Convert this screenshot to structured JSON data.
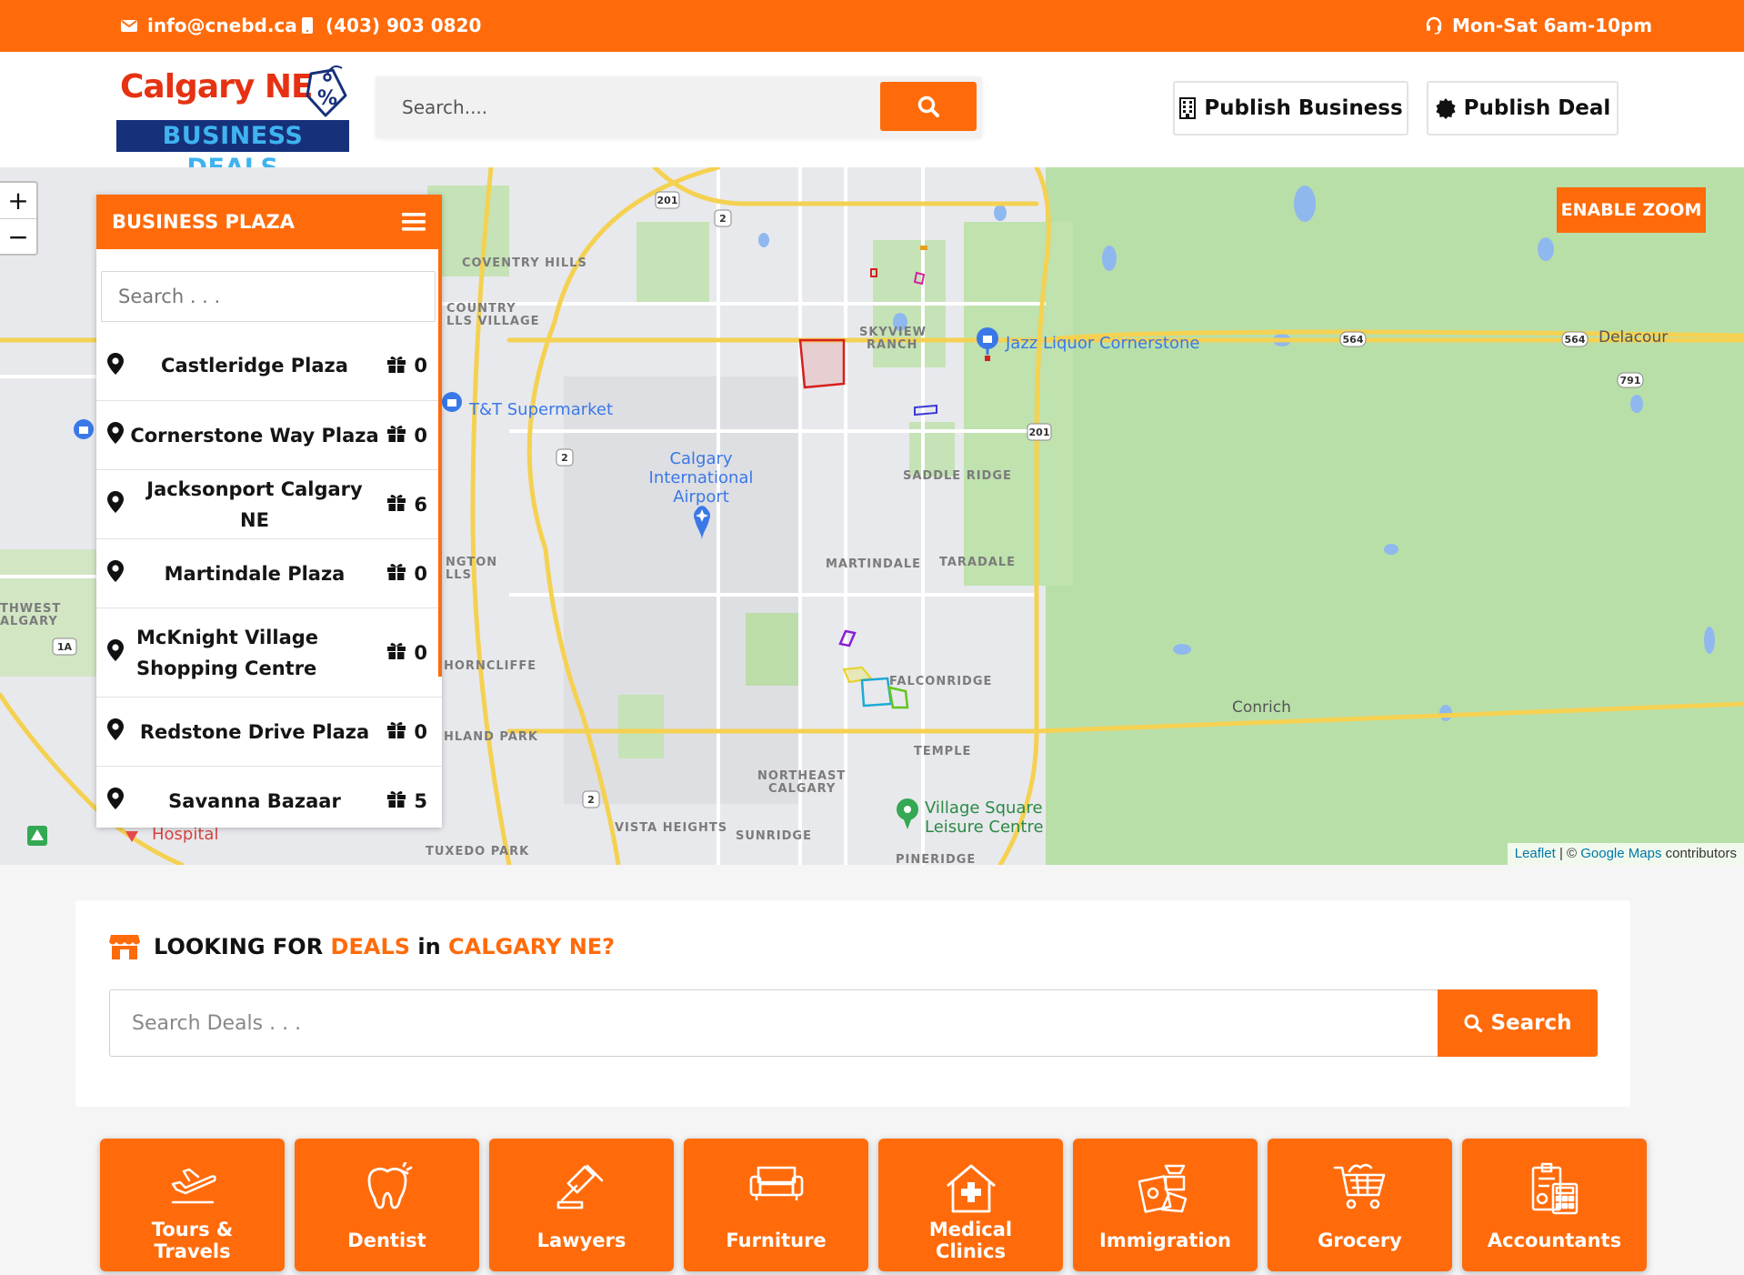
{
  "topbar": {
    "email": "info@cnebd.ca",
    "phone": "(403) 903 0820",
    "hours": "Mon-Sat 6am-10pm"
  },
  "header": {
    "logo_line1": "Calgary NE",
    "logo_line2": "BUSINESS DEALS",
    "search_placeholder": "Search....",
    "publish_business": "Publish Business",
    "publish_deal": "Publish Deal"
  },
  "map": {
    "zoom_in": "+",
    "zoom_out": "−",
    "enable_zoom": "ENABLE ZOOM",
    "attribution": {
      "leaflet": "Leaflet",
      "separator": " | © ",
      "google": "Google Maps",
      "suffix": " contributors"
    },
    "labels": {
      "coventry_hills": "COVENTRY HILLS",
      "country_hills_village_1": "COUNTRY",
      "country_hills_village_2": "LLS VILLAGE",
      "skyview_1": "SKYVIEW",
      "skyview_2": "RANCH",
      "saddle_ridge": "SADDLE RIDGE",
      "martindale": "MARTINDALE",
      "taradale": "TARADALE",
      "falconridge": "FALCONRIDGE",
      "temple": "TEMPLE",
      "northeast_1": "NORTHEAST",
      "northeast_2": "CALGARY",
      "sunridge": "SUNRIDGE",
      "pineridge": "PINERIDGE",
      "vista_heights": "VISTA HEIGHTS",
      "tuxedo_park": "TUXEDO PARK",
      "highland_park": "HLAND PARK",
      "thorncliffe": "HORNCLIFFE",
      "huntington_1": "NGTON",
      "huntington_2": "LLS",
      "northwest_1": "THWEST",
      "northwest_2": "ALGARY",
      "conrich": "Conrich",
      "delacour": "Delacour",
      "airport_1": "Calgary",
      "airport_2": "International",
      "airport_3": "Airport",
      "jazz": "Jazz Liquor Cornerstone",
      "tt": "T&T Supermarket",
      "village_1": "Village Square",
      "village_2": "Leisure Centre",
      "hospital": "Hospital",
      "hwy_201a": "201",
      "hwy_2a": "2",
      "hwy_2b": "2",
      "hwy_2c": "2",
      "hwy_201b": "201",
      "hwy_564a": "564",
      "hwy_564b": "564",
      "hwy_791": "791",
      "hwy_1a": "1A"
    }
  },
  "plaza": {
    "title": "BUSINESS PLAZA",
    "search_placeholder": "Search . . .",
    "items": [
      {
        "name": "Castleridge Plaza",
        "count": "0"
      },
      {
        "name": "Cornerstone Way Plaza",
        "count": "0"
      },
      {
        "name": "Jacksonport Calgary NE",
        "count": "6"
      },
      {
        "name": "Martindale Plaza",
        "count": "0"
      },
      {
        "name": "McKnight Village Shopping Centre",
        "count": "0"
      },
      {
        "name": "Redstone Drive Plaza",
        "count": "0"
      },
      {
        "name": "Savanna Bazaar",
        "count": "5"
      }
    ]
  },
  "deals": {
    "title_1": "LOOKING FOR ",
    "title_2": "DEALS",
    "title_3": " in ",
    "title_4": "CALGARY NE?",
    "placeholder": "Search Deals . . .",
    "button": "Search"
  },
  "categories": [
    {
      "line1": "Tours &",
      "line2": "Travels",
      "icon": "plane-icon"
    },
    {
      "line1": "Dentist",
      "line2": "",
      "icon": "tooth-icon"
    },
    {
      "line1": "Lawyers",
      "line2": "",
      "icon": "gavel-icon"
    },
    {
      "line1": "Furniture",
      "line2": "",
      "icon": "sofa-icon"
    },
    {
      "line1": "Medical",
      "line2": "Clinics",
      "icon": "clinic-icon"
    },
    {
      "line1": "Immigration",
      "line2": "",
      "icon": "passport-icon"
    },
    {
      "line1": "Grocery",
      "line2": "",
      "icon": "cart-icon"
    },
    {
      "line1": "Accountants",
      "line2": "",
      "icon": "calculator-icon"
    }
  ],
  "colors": {
    "brand_orange": "#ff6b0b",
    "logo_red": "#e63212",
    "logo_navy": "#16307a",
    "map_road": "#f5d152",
    "map_green": "#9ccf8f"
  }
}
